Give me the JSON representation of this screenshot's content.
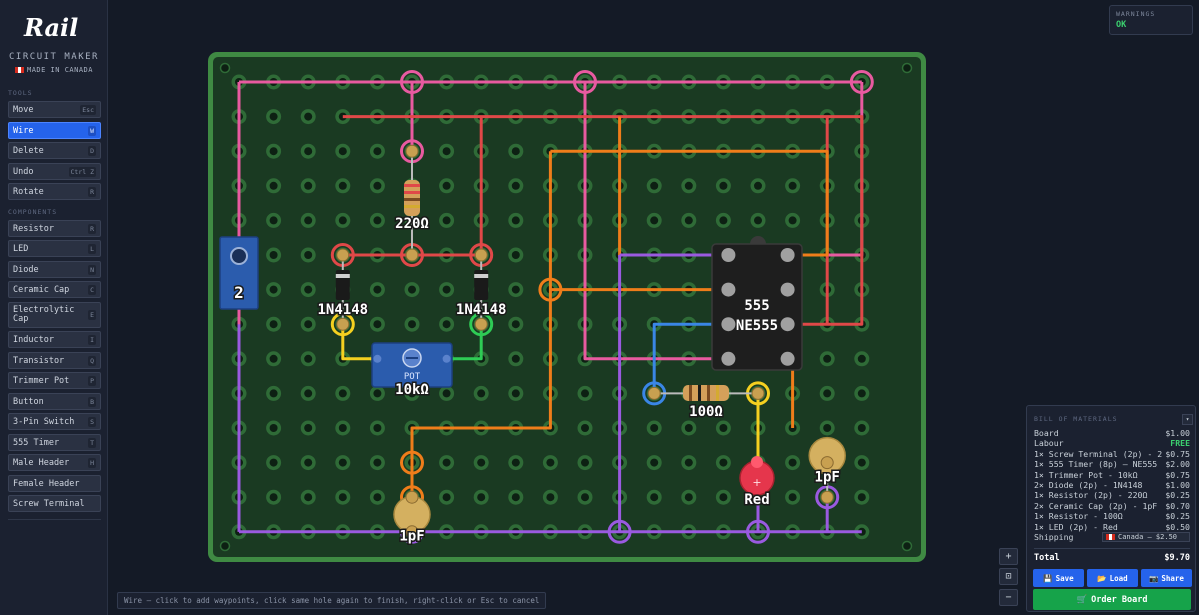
{
  "brand": {
    "logo_text": "Rail",
    "title": "CIRCUIT MAKER",
    "made_in": "MADE IN CANADA"
  },
  "sidebar": {
    "tools_label": "TOOLS",
    "tools": [
      {
        "label": "Move",
        "key": "Esc",
        "active": false
      },
      {
        "label": "Wire",
        "key": "W",
        "active": true
      },
      {
        "label": "Delete",
        "key": "D",
        "active": false
      },
      {
        "label": "Undo",
        "key": "Ctrl Z",
        "active": false
      },
      {
        "label": "Rotate",
        "key": "R",
        "active": false
      }
    ],
    "components_label": "COMPONENTS",
    "components": [
      {
        "label": "Resistor",
        "key": "R"
      },
      {
        "label": "LED",
        "key": "L"
      },
      {
        "label": "Diode",
        "key": "N"
      },
      {
        "label": "Ceramic Cap",
        "key": "C"
      },
      {
        "label": "Electrolytic Cap",
        "key": "E"
      },
      {
        "label": "Inductor",
        "key": "I"
      },
      {
        "label": "Transistor",
        "key": "Q"
      },
      {
        "label": "Trimmer Pot",
        "key": "P"
      },
      {
        "label": "Button",
        "key": "B"
      },
      {
        "label": "3-Pin Switch",
        "key": "S"
      },
      {
        "label": "555 Timer",
        "key": "T"
      },
      {
        "label": "Male Header",
        "key": "H"
      },
      {
        "label": "Female Header",
        "key": ""
      },
      {
        "label": "Screw Terminal",
        "key": ""
      }
    ]
  },
  "warnings": {
    "title": "WARNINGS",
    "status": "OK"
  },
  "board": {
    "labels": {
      "terminal": "2",
      "resistor_top": "220Ω",
      "diode_left": "1N4148",
      "diode_right": "1N4148",
      "pot_tag": "POT",
      "pot_value": "10kΩ",
      "cap_left": "1pF",
      "cap_right": "1pF",
      "timer_top": "555",
      "timer_bottom": "NE555",
      "resistor_right": "100Ω",
      "led": "Red"
    },
    "colors": {
      "board_bg": "#1a3a22",
      "frame": "#3f8a43",
      "pink": "#e85aa0",
      "red": "#e04848",
      "orange": "#ef7d1a",
      "purple": "#9a5ae0",
      "yellow": "#f5d020",
      "blue": "#3a86e6",
      "green": "#2ecc55"
    }
  },
  "bom": {
    "title": "BILL OF MATERIALS",
    "toggle": "▾",
    "rows": [
      {
        "item": "Board",
        "price": "$1.00"
      },
      {
        "item": "Labour",
        "price": "FREE"
      },
      {
        "item": "1× Screw Terminal (2p) - 2",
        "price": "$0.75"
      },
      {
        "item": "1× 555 Timer (8p) — NE555",
        "price": "$2.00"
      },
      {
        "item": "1× Trimmer Pot - 10kΩ",
        "price": "$0.75"
      },
      {
        "item": "2× Diode (2p) - 1N4148",
        "price": "$1.00"
      },
      {
        "item": "1× Resistor (2p) - 220Ω",
        "price": "$0.25"
      },
      {
        "item": "2× Ceramic Cap (2p) - 1pF",
        "price": "$0.70"
      },
      {
        "item": "1× Resistor - 100Ω",
        "price": "$0.25"
      },
      {
        "item": "1× LED (2p) - Red",
        "price": "$0.50"
      }
    ],
    "shipping_label": "Shipping",
    "shipping_value": "Canada — $2.50",
    "total_label": "Total",
    "total_value": "$9.70",
    "save": "Save",
    "load": "Load",
    "share": "Share",
    "order": "Order Board"
  },
  "zoom": {
    "in": "+",
    "fit": "⊡",
    "out": "−"
  },
  "hint": "Wire — click to add waypoints, click same hole again to finish, right-click or Esc to cancel"
}
